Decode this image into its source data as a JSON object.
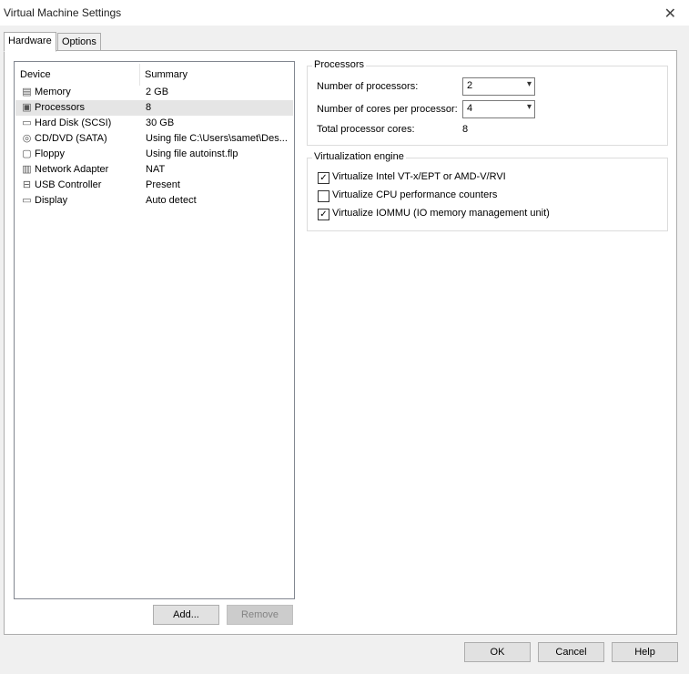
{
  "window": {
    "title": "Virtual Machine Settings"
  },
  "tabs": [
    {
      "label": "Hardware",
      "active": true
    },
    {
      "label": "Options",
      "active": false
    }
  ],
  "device_list": {
    "columns": [
      "Device",
      "Summary"
    ],
    "items": [
      {
        "name": "Memory",
        "summary": "2 GB",
        "icon": "memory-icon",
        "selected": false
      },
      {
        "name": "Processors",
        "summary": "8",
        "icon": "processor-icon",
        "selected": true
      },
      {
        "name": "Hard Disk (SCSI)",
        "summary": "30 GB",
        "icon": "hard-disk-icon",
        "selected": false
      },
      {
        "name": "CD/DVD (SATA)",
        "summary": "Using file C:\\Users\\samet\\Des...",
        "icon": "cd-dvd-icon",
        "selected": false
      },
      {
        "name": "Floppy",
        "summary": "Using file autoinst.flp",
        "icon": "floppy-icon",
        "selected": false
      },
      {
        "name": "Network Adapter",
        "summary": "NAT",
        "icon": "network-adapter-icon",
        "selected": false
      },
      {
        "name": "USB Controller",
        "summary": "Present",
        "icon": "usb-icon",
        "selected": false
      },
      {
        "name": "Display",
        "summary": "Auto detect",
        "icon": "display-icon",
        "selected": false
      }
    ]
  },
  "list_buttons": {
    "add": "Add...",
    "remove": "Remove"
  },
  "processors": {
    "title": "Processors",
    "num_processors_label": "Number of processors:",
    "num_processors_value": "2",
    "cores_label": "Number of cores per processor:",
    "cores_value": "4",
    "total_label": "Total processor cores:",
    "total_value": "8"
  },
  "virtualization": {
    "title": "Virtualization engine",
    "options": [
      {
        "label": "Virtualize Intel VT-x/EPT or AMD-V/RVI",
        "checked": true
      },
      {
        "label": "Virtualize CPU performance counters",
        "checked": false
      },
      {
        "label": "Virtualize IOMMU (IO memory management unit)",
        "checked": true
      }
    ]
  },
  "dialog_buttons": {
    "ok": "OK",
    "cancel": "Cancel",
    "help": "Help"
  }
}
